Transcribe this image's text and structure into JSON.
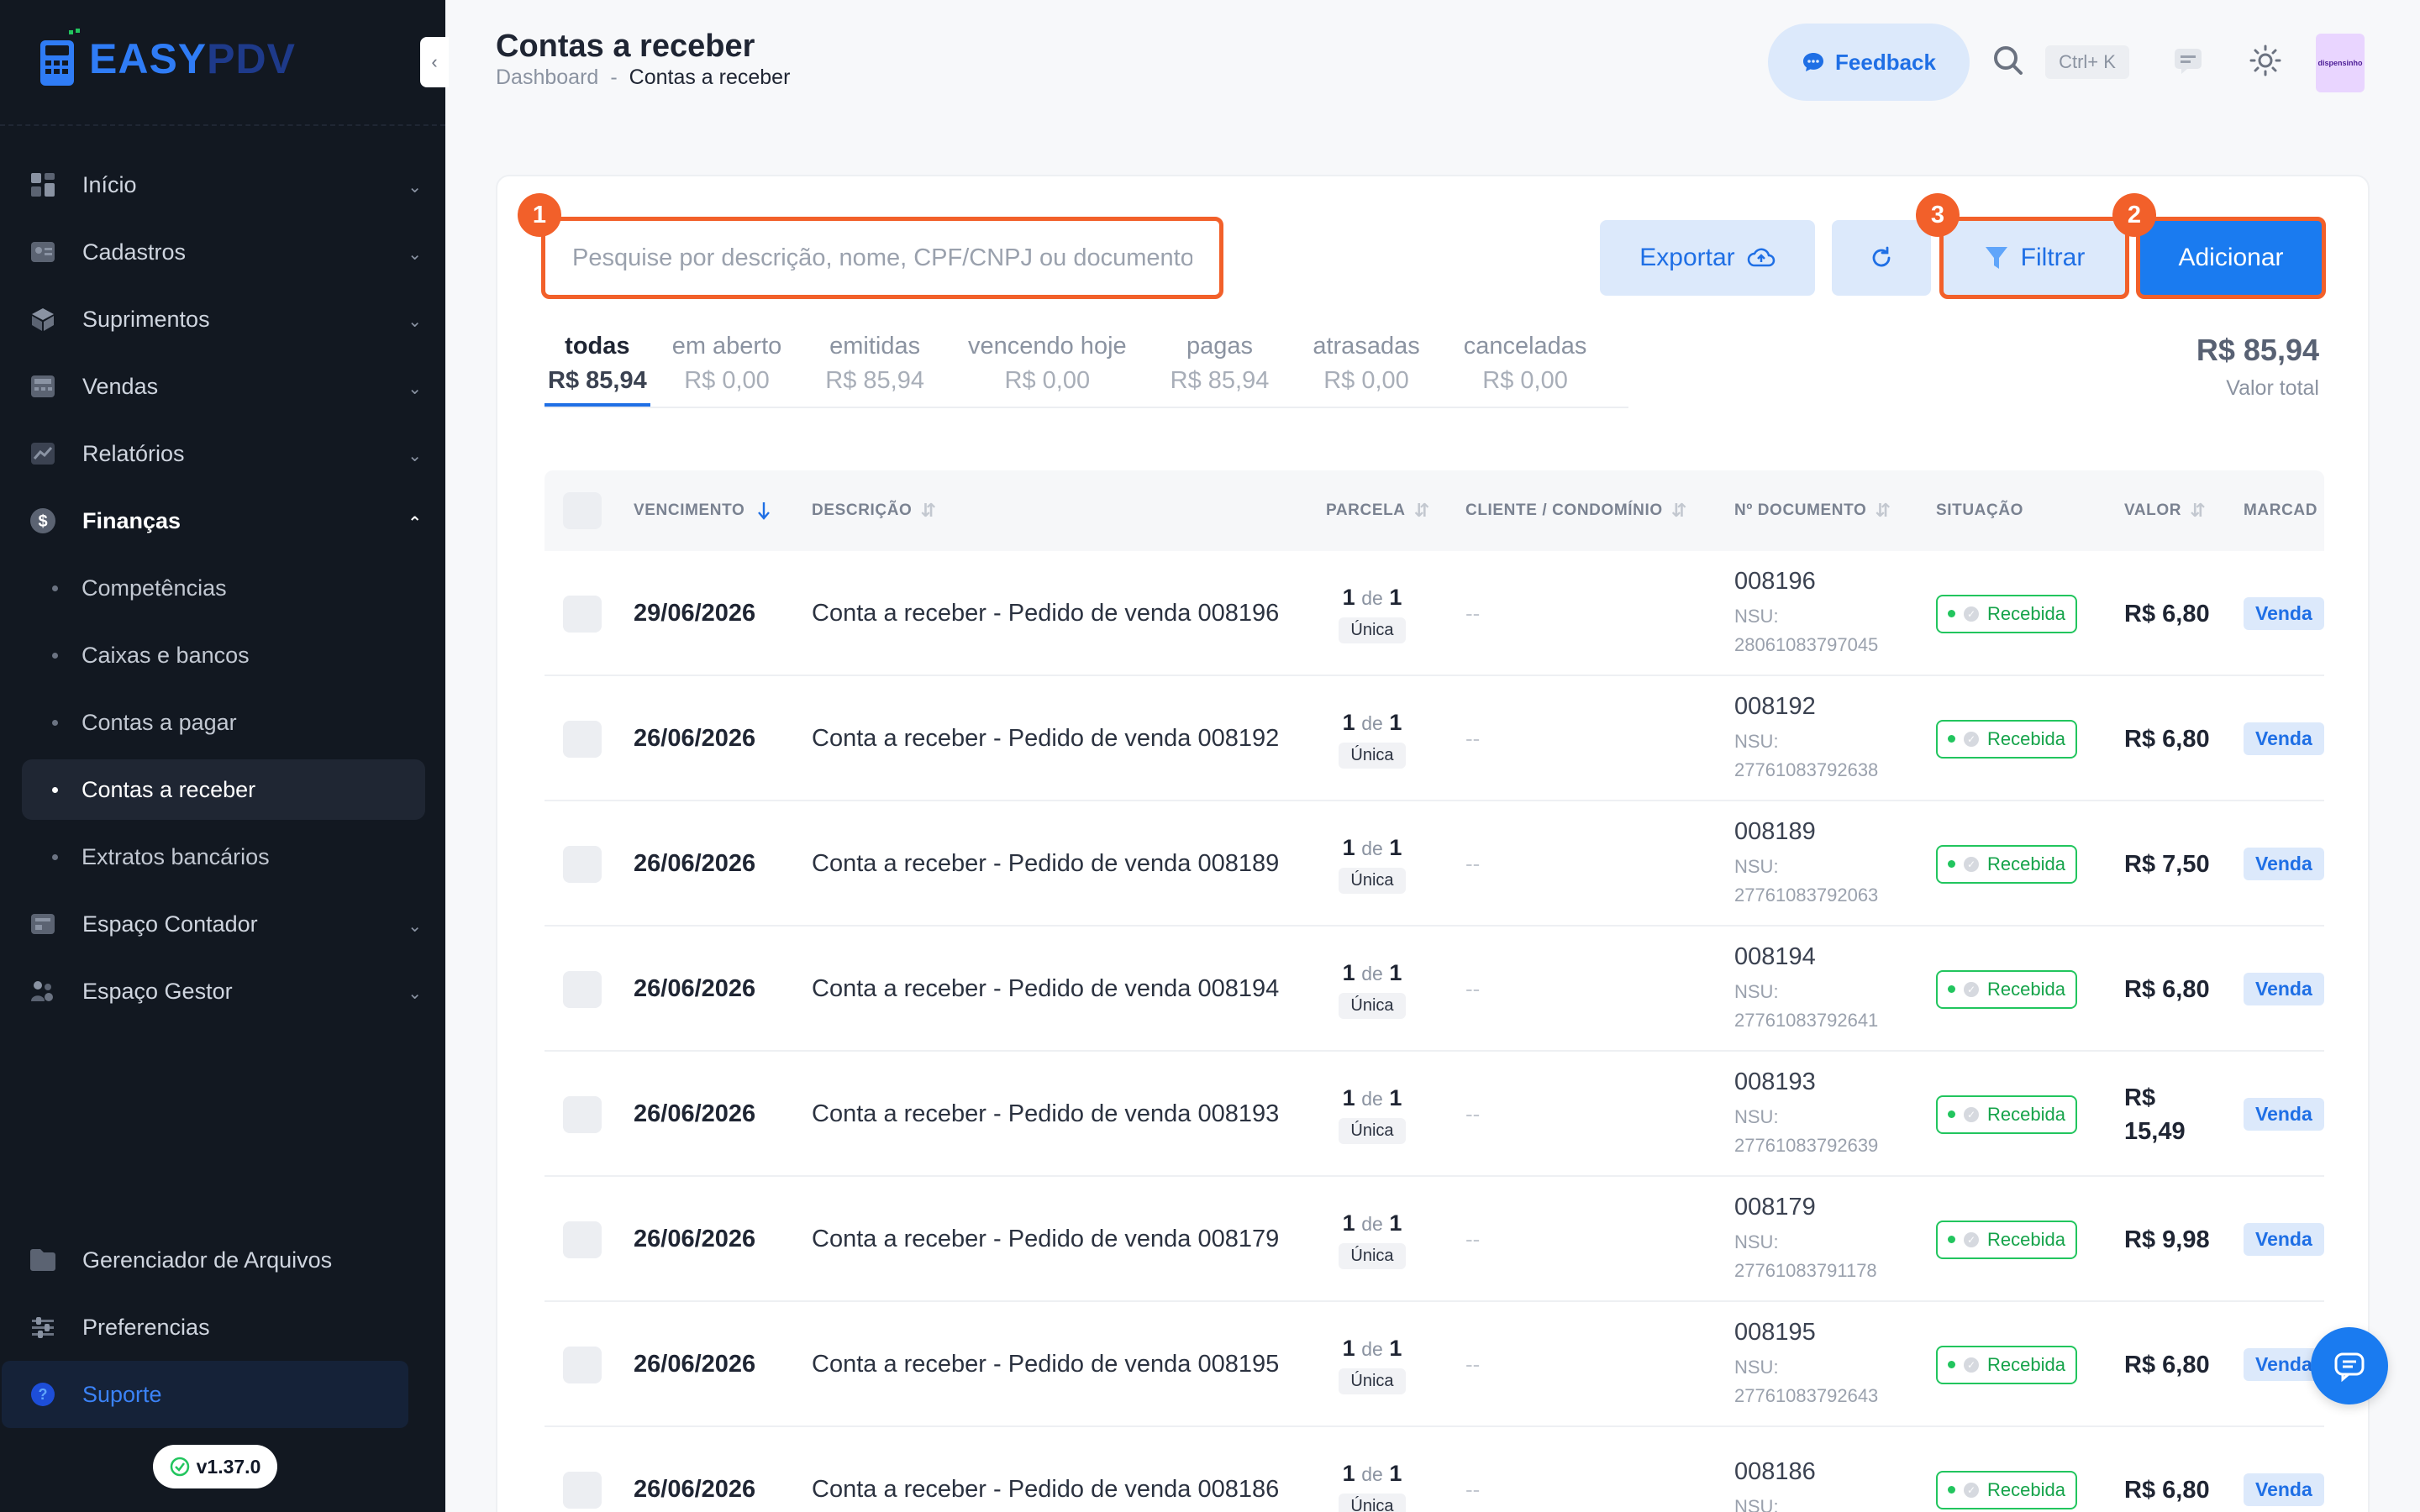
{
  "brand": {
    "word1": "EASY",
    "word2": "PDV"
  },
  "sidebar": {
    "items": [
      {
        "label": "Início",
        "icon": "grid-icon"
      },
      {
        "label": "Cadastros",
        "icon": "id-card-icon"
      },
      {
        "label": "Suprimentos",
        "icon": "box-icon"
      },
      {
        "label": "Vendas",
        "icon": "register-icon"
      },
      {
        "label": "Relatórios",
        "icon": "chart-line-icon"
      },
      {
        "label": "Finanças",
        "icon": "dollar-icon"
      }
    ],
    "finance_sub": [
      "Competências",
      "Caixas e bancos",
      "Contas a pagar",
      "Contas a receber",
      "Extratos bancários"
    ],
    "items_after": [
      {
        "label": "Espaço Contador",
        "icon": "calculator-icon"
      },
      {
        "label": "Espaço Gestor",
        "icon": "users-icon"
      }
    ],
    "bottom": [
      {
        "label": "Gerenciador de Arquivos",
        "icon": "folder-icon"
      },
      {
        "label": "Preferencias",
        "icon": "sliders-icon"
      },
      {
        "label": "Suporte",
        "icon": "help-icon"
      }
    ],
    "version": "v1.37.0"
  },
  "header": {
    "title": "Contas a receber",
    "breadcrumb": [
      "Dashboard",
      "-",
      "Contas a receber"
    ],
    "feedback_label": "Feedback",
    "shortcut": "Ctrl+ K",
    "avatar_text": "dispensinho"
  },
  "toolbar": {
    "search_placeholder": "Pesquise por descrição, nome, CPF/CNPJ ou documento",
    "export_label": "Exportar",
    "filter_label": "Filtrar",
    "add_label": "Adicionar",
    "markers": [
      "1",
      "2",
      "3"
    ]
  },
  "tabs": [
    {
      "label": "todas",
      "value": "R$ 85,94"
    },
    {
      "label": "em aberto",
      "value": "R$ 0,00"
    },
    {
      "label": "emitidas",
      "value": "R$ 85,94"
    },
    {
      "label": "vencendo hoje",
      "value": "R$ 0,00"
    },
    {
      "label": "pagas",
      "value": "R$ 85,94"
    },
    {
      "label": "atrasadas",
      "value": "R$ 0,00"
    },
    {
      "label": "canceladas",
      "value": "R$ 0,00"
    }
  ],
  "total": {
    "amount": "R$ 85,94",
    "label": "Valor total"
  },
  "table": {
    "headers": [
      "VENCIMENTO",
      "DESCRIÇÃO",
      "PARCELA",
      "CLIENTE / CONDOMÍNIO",
      "Nº DOCUMENTO",
      "SITUAÇÃO",
      "VALOR",
      "MARCAD"
    ],
    "parcela_de": "de",
    "rows": [
      {
        "date": "29/06/2026",
        "desc": "Conta a receber - Pedido de venda 008196",
        "p_a": "1",
        "p_b": "1",
        "p_type": "Única",
        "cliente": "--",
        "doc": "008196",
        "nsu": "NSU: 28061083797045",
        "status": "Recebida",
        "valor": "R$ 6,80",
        "marca": "Venda"
      },
      {
        "date": "26/06/2026",
        "desc": "Conta a receber - Pedido de venda 008192",
        "p_a": "1",
        "p_b": "1",
        "p_type": "Única",
        "cliente": "--",
        "doc": "008192",
        "nsu": "NSU: 27761083792638",
        "status": "Recebida",
        "valor": "R$ 6,80",
        "marca": "Venda"
      },
      {
        "date": "26/06/2026",
        "desc": "Conta a receber - Pedido de venda 008189",
        "p_a": "1",
        "p_b": "1",
        "p_type": "Única",
        "cliente": "--",
        "doc": "008189",
        "nsu": "NSU: 27761083792063",
        "status": "Recebida",
        "valor": "R$ 7,50",
        "marca": "Venda"
      },
      {
        "date": "26/06/2026",
        "desc": "Conta a receber - Pedido de venda 008194",
        "p_a": "1",
        "p_b": "1",
        "p_type": "Única",
        "cliente": "--",
        "doc": "008194",
        "nsu": "NSU: 27761083792641",
        "status": "Recebida",
        "valor": "R$ 6,80",
        "marca": "Venda"
      },
      {
        "date": "26/06/2026",
        "desc": "Conta a receber - Pedido de venda 008193",
        "p_a": "1",
        "p_b": "1",
        "p_type": "Única",
        "cliente": "--",
        "doc": "008193",
        "nsu": "NSU: 27761083792639",
        "status": "Recebida",
        "valor": "R$ 15,49",
        "marca": "Venda"
      },
      {
        "date": "26/06/2026",
        "desc": "Conta a receber - Pedido de venda 008179",
        "p_a": "1",
        "p_b": "1",
        "p_type": "Única",
        "cliente": "--",
        "doc": "008179",
        "nsu": "NSU: 27761083791178",
        "status": "Recebida",
        "valor": "R$ 9,98",
        "marca": "Venda"
      },
      {
        "date": "26/06/2026",
        "desc": "Conta a receber - Pedido de venda 008195",
        "p_a": "1",
        "p_b": "1",
        "p_type": "Única",
        "cliente": "--",
        "doc": "008195",
        "nsu": "NSU: 27761083792643",
        "status": "Recebida",
        "valor": "R$ 6,80",
        "marca": "Venda"
      },
      {
        "date": "26/06/2026",
        "desc": "Conta a receber - Pedido de venda 008186",
        "p_a": "1",
        "p_b": "1",
        "p_type": "Única",
        "cliente": "--",
        "doc": "008186",
        "nsu": "NSU:",
        "status": "Recebida",
        "valor": "R$ 6,80",
        "marca": "Venda"
      }
    ]
  }
}
